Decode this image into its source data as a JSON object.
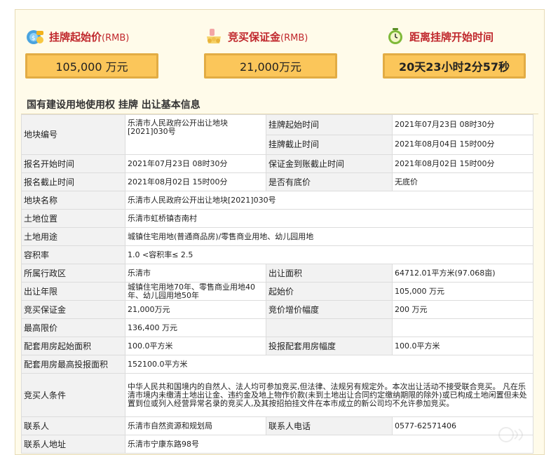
{
  "cards": [
    {
      "title": "挂牌起始价",
      "unit": "(RMB)",
      "value": "105,000 万元",
      "icon": "money-bag-icon"
    },
    {
      "title": "竞买保证金",
      "unit": "(RMB)",
      "value": "21,000万元",
      "icon": "gift-coins-icon"
    },
    {
      "title": "距离挂牌开始时间",
      "unit": "",
      "value": "20天23小时2分57秒",
      "icon": "alarm-clock-icon"
    }
  ],
  "section_title": "国有建设用地使用权 挂牌 出让基本信息",
  "table": {
    "land_id_label": "地块编号",
    "land_id_value": "乐清市人民政府公开出让地块[2021]030号",
    "listing_start_label": "挂牌起始时间",
    "listing_start_value": "2021年07月23日 08时30分",
    "listing_end_label": "挂牌截止时间",
    "listing_end_value": "2021年08月04日 15时00分",
    "reg_start_label": "报名开始时间",
    "reg_start_value": "2021年07月23日 08时30分",
    "deposit_deadline_label": "保证金到账截止时间",
    "deposit_deadline_value": "2021年08月02日 15时00分",
    "reg_end_label": "报名截止时间",
    "reg_end_value": "2021年08月02日 15时00分",
    "reserve_label": "是否有底价",
    "reserve_value": "无底价",
    "name_label": "地块名称",
    "name_value": "乐清市人民政府公开出让地块[2021]030号",
    "location_label": "土地位置",
    "location_value": "乐清市虹桥镇杏南村",
    "usage_label": "土地用途",
    "usage_value": "城镇住宅用地(普通商品房)/零售商业用地、幼儿园用地",
    "far_label": "容积率",
    "far_value": "1.0 <容积率≤ 2.5",
    "district_label": "所属行政区",
    "district_value": "乐清市",
    "area_label": "出让面积",
    "area_value": "64712.01平方米(97.068亩)",
    "term_label": "出让年限",
    "term_value": "城镇住宅用地70年、零售商业用地40年、幼儿园用地50年",
    "start_price_label": "起始价",
    "start_price_value": "105,000 万元",
    "deposit_label": "竞买保证金",
    "deposit_value": "21,000万元",
    "increment_label": "竞价增价幅度",
    "increment_value": "200 万元",
    "max_price_label": "最高限价",
    "max_price_value": "136,400 万元",
    "housing_start_label": "配套用房起始面积",
    "housing_start_value": "100.0平方米",
    "housing_increment_label": "投报配套用房幅度",
    "housing_increment_value": "100.0平方米",
    "housing_max_label": "配套用房最高投报面积",
    "housing_max_value": "152100.0平方米",
    "bidder_label": "竞买人条件",
    "bidder_value": "中华人民共和国境内的自然人、法人均可参加竞买,但法律、法规另有规定外。本次出让活动不接受联合竞买。 凡在乐清市境内未缴清土地出让金、违约金及地上物作价款(未到土地出让合同约定缴纳期限的除外)或已构成土地闲置但未处置到位或列入经营异常名录的竞买人,及其按招拍挂文件在本市成立的新公司均不允许参加竞买。",
    "contact_label": "联系人",
    "contact_value": "乐清市自然资源和规划局",
    "phone_label": "联系人电话",
    "phone_value": "0577-62571406",
    "address_label": "联系人地址",
    "address_value": "乐清市宁康东路98号"
  },
  "colors": {
    "accent_red": "#c0282d",
    "box_fill": "#fbc65a",
    "box_border": "#e2ac44",
    "panel_bg": "#fffbea"
  }
}
